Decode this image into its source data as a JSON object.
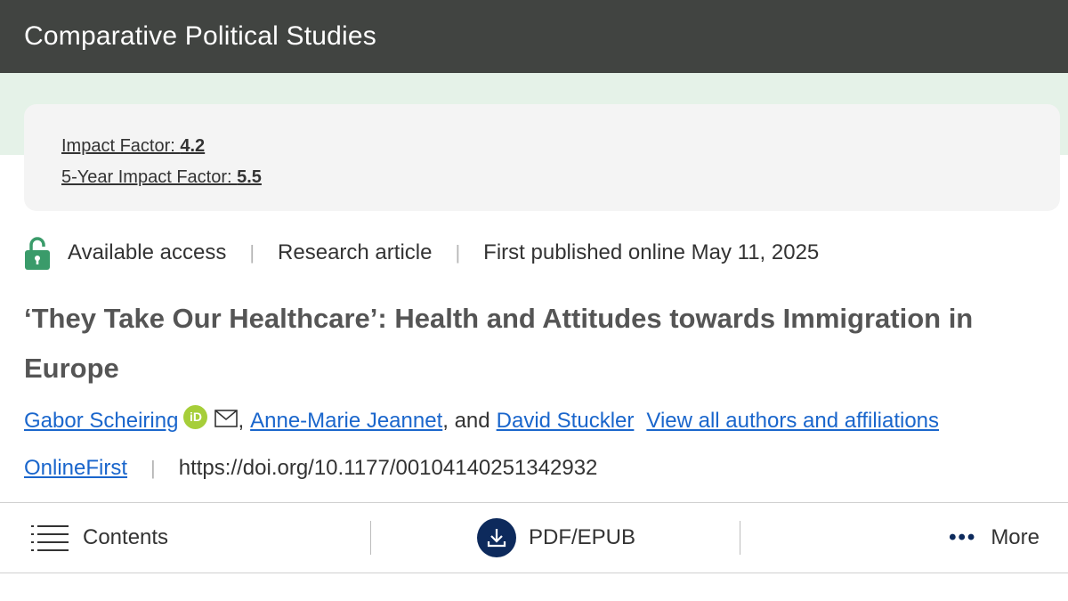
{
  "header": {
    "journal_title": "Comparative Political Studies"
  },
  "metrics": {
    "impact_factor_label": "Impact Factor: ",
    "impact_factor_value": "4.2",
    "five_year_label": "5-Year Impact Factor: ",
    "five_year_value": "5.5"
  },
  "meta": {
    "access": "Available access",
    "article_type": "Research article",
    "published": "First published online May 11, 2025"
  },
  "article": {
    "title": "‘They Take Our Healthcare’: Health and Attitudes towards Immigration in Europe"
  },
  "authors": {
    "author1": "Gabor Scheiring",
    "orcid_badge": "iD",
    "comma": ",",
    "author2": "Anne-Marie Jeannet",
    "and_text": ", and",
    "author3": "David Stuckler",
    "view_all": "View all authors and affiliations"
  },
  "doi": {
    "online_first": "OnlineFirst",
    "url": "https://doi.org/10.1177/00104140251342932"
  },
  "toolbar": {
    "contents_label": "Contents",
    "pdf_label": "PDF/EPUB",
    "more_label": "More"
  },
  "icons": {
    "lock": "lock-open-icon",
    "orcid": "orcid-icon",
    "mail": "mail-icon",
    "contents": "list-icon",
    "pdf": "download-icon",
    "more": "ellipsis-icon"
  },
  "colors": {
    "header_bg": "#414441",
    "band_bg": "#e5f2e8",
    "link": "#1a66cc",
    "access_green": "#3a9b6a",
    "orcid_green": "#a6ce39",
    "pdf_navy": "#0d2a5c"
  }
}
